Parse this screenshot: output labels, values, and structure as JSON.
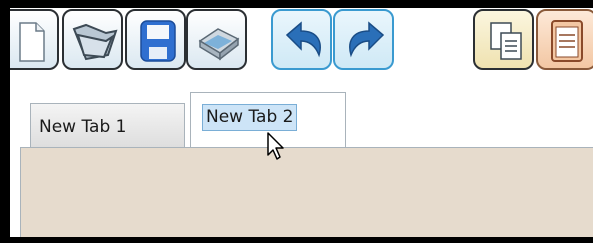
{
  "toolbar": {
    "buttons": [
      {
        "name": "new",
        "icon": "new-document-icon"
      },
      {
        "name": "open",
        "icon": "open-folder-icon"
      },
      {
        "name": "save",
        "icon": "save-disk-icon"
      },
      {
        "name": "print",
        "icon": "printer-icon"
      },
      {
        "name": "undo",
        "icon": "undo-arrow-icon"
      },
      {
        "name": "redo",
        "icon": "redo-arrow-icon"
      },
      {
        "name": "copy",
        "icon": "copy-icon"
      },
      {
        "name": "paste",
        "icon": "paste-clipboard-icon"
      }
    ]
  },
  "tabs": [
    {
      "label": "New Tab 1",
      "active": false
    },
    {
      "label": "New Tab 2",
      "active": true,
      "editing": true
    }
  ],
  "colors": {
    "content_background": "#e6dbcd",
    "selection": "#cde4f7",
    "accent": "#3a9ad0"
  }
}
